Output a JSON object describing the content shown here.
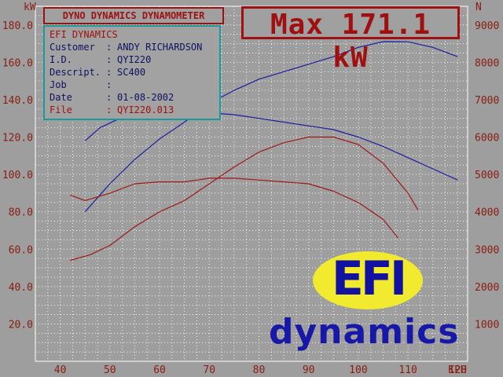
{
  "header": {
    "title": "DYNO DYNAMICS DYNAMOMETER",
    "max_text": "Max 171.1 kW"
  },
  "info": {
    "company": "EFI DYNAMICS",
    "rows": [
      {
        "key": "Customer",
        "value": "ANDY RICHARDSON"
      },
      {
        "key": "I.D.",
        "value": "QYI220"
      },
      {
        "key": "Descript.",
        "value": "SC400"
      },
      {
        "key": "Job",
        "value": ""
      },
      {
        "key": "Date",
        "value": "01-08-2002"
      },
      {
        "key": "File",
        "value": "QYI220.013"
      }
    ]
  },
  "logo": {
    "top_text": "EFI",
    "bottom_text": "dynamics",
    "oval_color": "#f2ea2e",
    "text_color": "#1818a8"
  },
  "chart_data": {
    "type": "line",
    "xlabel": "KPH",
    "ylabel": "kW",
    "y2label": "N",
    "xlim": [
      35,
      122
    ],
    "ylim": [
      0,
      190
    ],
    "y2lim": [
      0,
      9500
    ],
    "x_ticks": [
      "40",
      "50",
      "60",
      "70",
      "80",
      "90",
      "100",
      "110",
      "120"
    ],
    "y_ticks": [
      "20.0",
      "40.0",
      "60.0",
      "80.0",
      "100.0",
      "120.0",
      "140.0",
      "160.0",
      "180.0"
    ],
    "y2_ticks": [
      "1000",
      "2000",
      "3000",
      "4000",
      "5000",
      "6000",
      "7000",
      "8000",
      "9000"
    ],
    "grid": true,
    "colors": {
      "blue": "#1c1ca0",
      "red": "#a01818",
      "grid": "#ffffff",
      "axis_text": "#8a1c10"
    },
    "series": [
      {
        "color": "#1c1ca0",
        "x": [
          45,
          50,
          55,
          60,
          65,
          70,
          75,
          80,
          85,
          90,
          95,
          100,
          105,
          110,
          115,
          120
        ],
        "y": [
          80,
          95,
          108,
          119,
          128,
          138,
          145,
          151,
          155,
          159,
          163,
          168,
          171.1,
          171,
          168,
          163
        ]
      },
      {
        "color": "#1c1ca0",
        "x": [
          45,
          48,
          52,
          56,
          60,
          65,
          70,
          75,
          80,
          85,
          90,
          95,
          100,
          105,
          110,
          115,
          120
        ],
        "y": [
          118,
          125,
          130,
          133,
          134,
          134,
          133,
          132,
          130,
          128,
          126,
          124,
          120,
          115,
          109,
          103,
          97
        ]
      },
      {
        "color": "#a01818",
        "x": [
          42,
          46,
          50,
          55,
          60,
          65,
          70,
          75,
          80,
          85,
          90,
          95,
          100,
          105,
          110,
          112
        ],
        "y": [
          54,
          57,
          62,
          72,
          80,
          86,
          95,
          104,
          112,
          117,
          120,
          120,
          116,
          106,
          90,
          81
        ]
      },
      {
        "color": "#a01818",
        "x": [
          42,
          45,
          50,
          55,
          60,
          65,
          70,
          75,
          80,
          85,
          90,
          95,
          100,
          105,
          108
        ],
        "y": [
          89,
          86,
          90,
          95,
          96,
          96,
          98,
          98,
          97,
          96,
          95,
          91,
          85,
          76,
          66
        ]
      }
    ]
  }
}
